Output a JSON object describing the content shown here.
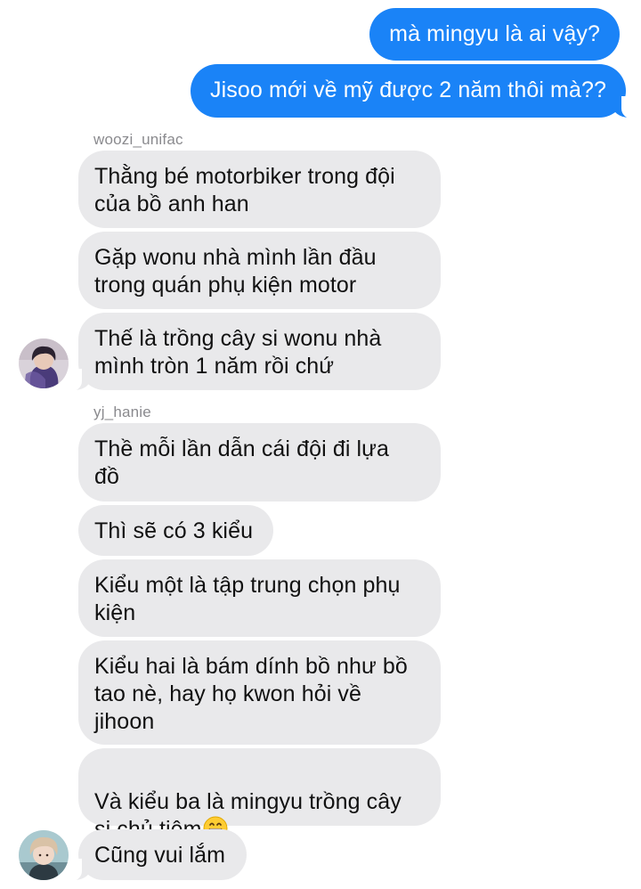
{
  "outgoing": [
    {
      "text": "mà mingyu là ai vậy?"
    },
    {
      "text": "Jisoo mới về mỹ được 2 năm thôi mà??"
    }
  ],
  "groups": [
    {
      "sender": "woozi_unifac",
      "avatar_icon": "profile-photo-dark-hair",
      "messages": [
        "Thằng bé motorbiker trong đội\ncủa bồ anh han",
        "Gặp wonu nhà mình lần đầu\ntrong quán phụ kiện motor",
        "Thế là trồng cây si wonu nhà\nmình tròn 1 năm rồi chứ"
      ]
    },
    {
      "sender": "yj_hanie",
      "avatar_icon": "profile-photo-light-hair",
      "messages": [
        "Thề mỗi lần dẫn cái đội đi lựa\nđồ",
        "Thì sẽ có 3 kiểu",
        "Kiểu một là tập trung chọn phụ\nkiện",
        "Kiểu hai là bám dính bồ như bồ\ntao nè, hay họ kwon hỏi về\njihoon",
        "Và kiểu ba là mingyu trồng cây\nsi chủ tiệm",
        "Cũng vui lắm"
      ],
      "emoji_icon": "grinning-face-emoji"
    }
  ],
  "colors": {
    "outgoing_bubble": "#1a83f7",
    "incoming_bubble": "#e9e9eb",
    "sender_label": "#8a8a8e"
  }
}
